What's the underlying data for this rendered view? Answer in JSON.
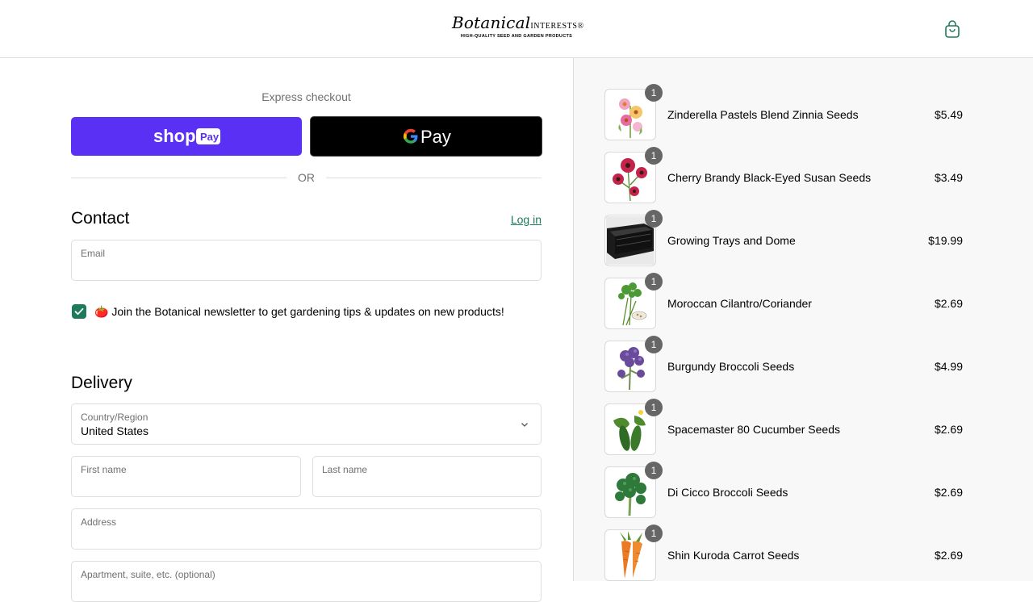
{
  "header": {
    "logo_script": "Botanical",
    "logo_caps": "INTERESTS",
    "logo_reg": "®",
    "logo_tagline": "HIGH-QUALITY SEED AND GARDEN PRODUCTS",
    "cart_icon": "shopping-bag-icon"
  },
  "express": {
    "title": "Express checkout",
    "shop_pay_brand": "shop",
    "shop_pay_badge": "Pay",
    "gpay_label": "Pay",
    "or_text": "OR"
  },
  "contact": {
    "heading": "Contact",
    "login_label": "Log in",
    "email_label": "Email",
    "email_value": "",
    "newsletter_checked": true,
    "newsletter_text": "🍅 Join the Botanical newsletter to get gardening tips & updates on new products!"
  },
  "delivery": {
    "heading": "Delivery",
    "country_label": "Country/Region",
    "country_value": "United States",
    "first_name_label": "First name",
    "last_name_label": "Last name",
    "address_label": "Address",
    "apartment_label": "Apartment, suite, etc. (optional)"
  },
  "cart": {
    "items": [
      {
        "qty": "1",
        "name": "Zinderella Pastels Blend Zinnia Seeds",
        "price": "$5.49",
        "thumb_icon": "pink-zinnia-icon"
      },
      {
        "qty": "1",
        "name": "Cherry Brandy Black-Eyed Susan Seeds",
        "price": "$3.49",
        "thumb_icon": "red-flower-icon"
      },
      {
        "qty": "1",
        "name": "Growing Trays and Dome",
        "price": "$19.99",
        "thumb_icon": "black-tray-icon"
      },
      {
        "qty": "1",
        "name": "Moroccan Cilantro/Coriander",
        "price": "$2.69",
        "thumb_icon": "cilantro-icon"
      },
      {
        "qty": "1",
        "name": "Burgundy Broccoli Seeds",
        "price": "$4.99",
        "thumb_icon": "purple-broccoli-icon"
      },
      {
        "qty": "1",
        "name": "Spacemaster 80 Cucumber Seeds",
        "price": "$2.69",
        "thumb_icon": "cucumber-icon"
      },
      {
        "qty": "1",
        "name": "Di Cicco Broccoli Seeds",
        "price": "$2.69",
        "thumb_icon": "broccoli-icon"
      },
      {
        "qty": "1",
        "name": "Shin Kuroda Carrot Seeds",
        "price": "$2.69",
        "thumb_icon": "carrot-icon"
      }
    ]
  },
  "colors": {
    "accent": "#1d7a5c",
    "shop_pay": "#5a31f4",
    "gpay": "#000000",
    "sidebar_bg": "#f8f8f8"
  }
}
